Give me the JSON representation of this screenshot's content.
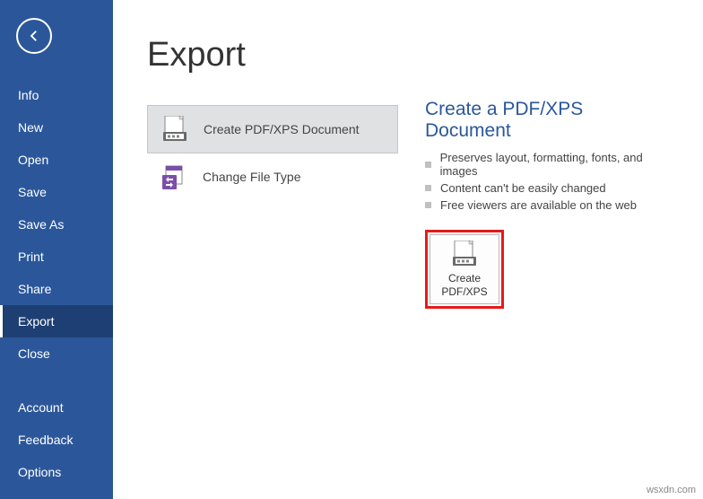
{
  "sidebar": {
    "items": [
      {
        "label": "Info",
        "selected": false
      },
      {
        "label": "New",
        "selected": false
      },
      {
        "label": "Open",
        "selected": false
      },
      {
        "label": "Save",
        "selected": false
      },
      {
        "label": "Save As",
        "selected": false
      },
      {
        "label": "Print",
        "selected": false
      },
      {
        "label": "Share",
        "selected": false
      },
      {
        "label": "Export",
        "selected": true
      },
      {
        "label": "Close",
        "selected": false
      }
    ],
    "footer_items": [
      {
        "label": "Account"
      },
      {
        "label": "Feedback"
      },
      {
        "label": "Options"
      }
    ]
  },
  "page_title": "Export",
  "export_options": [
    {
      "label": "Create PDF/XPS Document",
      "selected": true,
      "icon": "pdf-doc"
    },
    {
      "label": "Change File Type",
      "selected": false,
      "icon": "file-type"
    }
  ],
  "detail": {
    "title": "Create a PDF/XPS Document",
    "bullets": [
      "Preserves layout, formatting, fonts, and images",
      "Content can't be easily changed",
      "Free viewers are available on the web"
    ],
    "button_label": "Create PDF/XPS"
  },
  "watermark": "wsxdn.com"
}
